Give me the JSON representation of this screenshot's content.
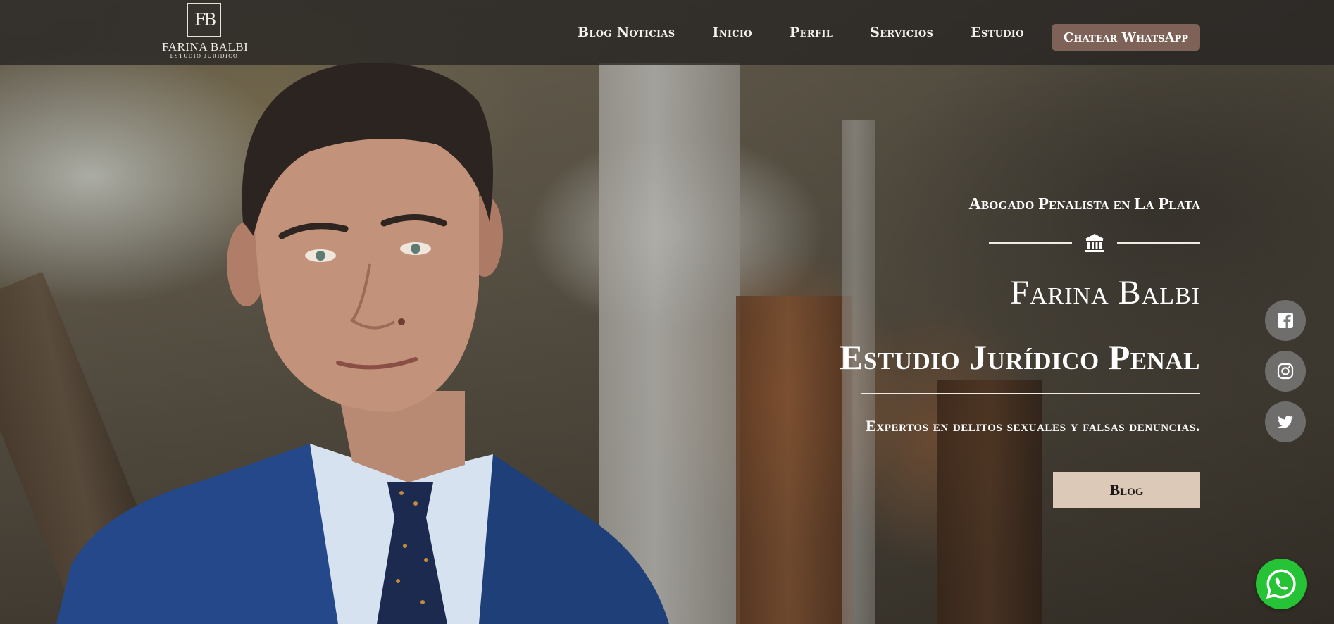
{
  "brand": {
    "monogram": "FB",
    "name": "FARINA BALBI",
    "subtitle": "ESTUDIO JURIDICO"
  },
  "nav": {
    "items": [
      {
        "label": "Blog Noticias"
      },
      {
        "label": "Inicio"
      },
      {
        "label": "Perfil"
      },
      {
        "label": "Servicios"
      },
      {
        "label": "Estudio"
      }
    ],
    "cta_label": "Chatear WhatsApp"
  },
  "hero": {
    "eyebrow": "Abogado Penalista en La Plata",
    "name": "Farina Balbi",
    "title": "Estudio Jurídico Penal",
    "tagline": "Expertos en delitos sexuales y falsas denuncias.",
    "button_label": "Blog"
  },
  "icons": {
    "divider": "bank-columns-icon",
    "facebook": "facebook-icon",
    "instagram": "instagram-icon",
    "twitter": "twitter-icon",
    "whatsapp": "whatsapp-icon"
  },
  "colors": {
    "navbar_bg": "#262423",
    "cta_bg": "#7e6257",
    "blog_btn_bg": "#dcc9b8",
    "social_bg": "#808080",
    "whatsapp_green": "#25c335"
  }
}
